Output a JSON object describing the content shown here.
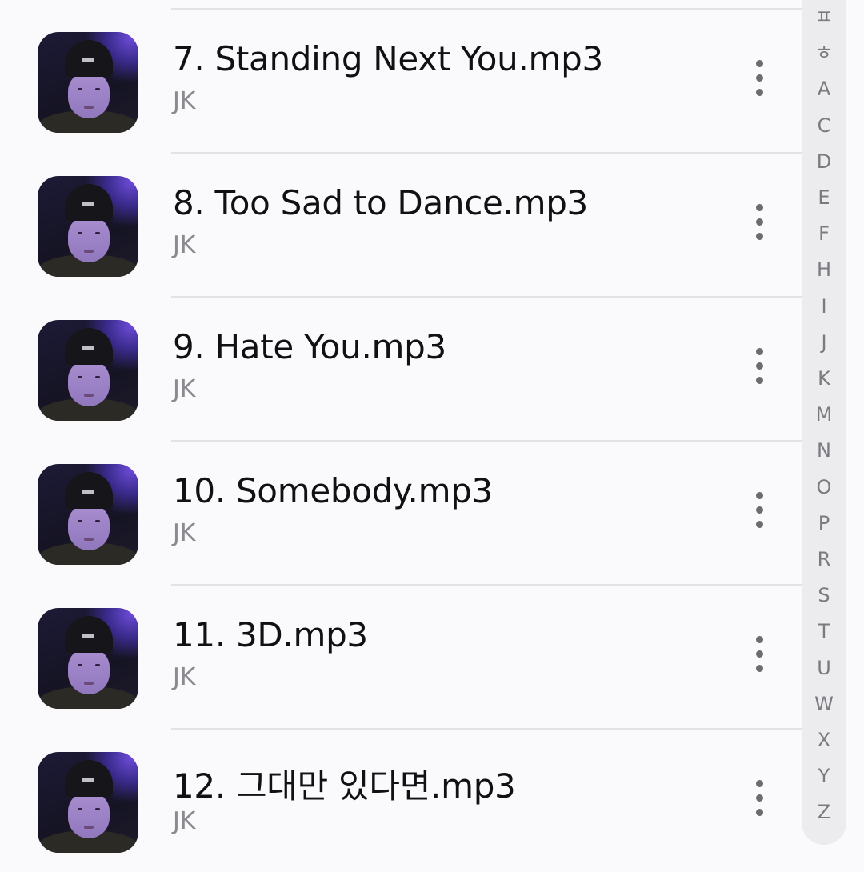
{
  "tracks": [
    {
      "title": "7. Standing Next You.mp3",
      "artist": "JK"
    },
    {
      "title": "8. Too Sad to Dance.mp3",
      "artist": "JK"
    },
    {
      "title": "9. Hate You.mp3",
      "artist": "JK"
    },
    {
      "title": "10. Somebody.mp3",
      "artist": "JK"
    },
    {
      "title": "11. 3D.mp3",
      "artist": "JK"
    },
    {
      "title": "12. 그대만 있다면.mp3",
      "artist": "JK"
    }
  ],
  "index_letters": [
    "ㅍ",
    "ㅎ",
    "A",
    "C",
    "D",
    "E",
    "F",
    "H",
    "I",
    "J",
    "K",
    "M",
    "N",
    "O",
    "P",
    "R",
    "S",
    "T",
    "U",
    "W",
    "X",
    "Y",
    "Z"
  ],
  "icons": {
    "more": "more-vertical-icon"
  },
  "colors": {
    "background": "#fafafc",
    "title": "#111114",
    "artist": "#8b8b8f",
    "index_bar": "#ececef"
  }
}
